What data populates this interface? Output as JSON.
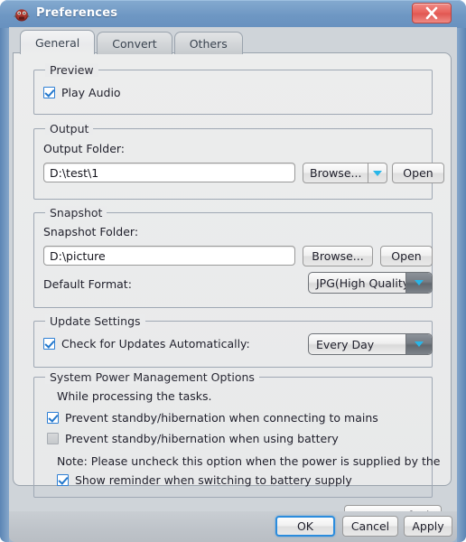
{
  "window": {
    "title": "Preferences",
    "icon": "app-icon",
    "close_label": "X",
    "frame_color": "#6e97c3",
    "close_color": "#e8625c"
  },
  "tabs": [
    {
      "label": "General",
      "active": true
    },
    {
      "label": "Convert",
      "active": false
    },
    {
      "label": "Others",
      "active": false
    }
  ],
  "groups": {
    "preview": {
      "legend": "Preview",
      "play_audio": {
        "label": "Play Audio",
        "checked": true
      }
    },
    "output": {
      "legend": "Output",
      "folder_label": "Output Folder:",
      "folder_value": "D:\\test\\1",
      "browse_label": "Browse...",
      "open_label": "Open"
    },
    "snapshot": {
      "legend": "Snapshot",
      "folder_label": "Snapshot Folder:",
      "folder_value": "D:\\picture",
      "browse_label": "Browse...",
      "open_label": "Open",
      "format_label": "Default Format:",
      "format_value": "JPG(High Quality)"
    },
    "update": {
      "legend": "Update Settings",
      "check_label": "Check for Updates Automatically:",
      "check_checked": true,
      "frequency_value": "Every Day"
    },
    "power": {
      "legend": "System Power Management Options",
      "intro": "While processing the tasks.",
      "mains": {
        "label": "Prevent standby/hibernation when connecting to mains",
        "checked": true
      },
      "battery": {
        "label": "Prevent standby/hibernation when using battery",
        "checked": false,
        "disabled": true
      },
      "note": "Note: Please uncheck this option when the power is supplied by the",
      "reminder": {
        "label": "Show reminder when switching to battery supply",
        "checked": true
      }
    }
  },
  "actions": {
    "restore_defaults": "Restore Defaults",
    "ok": "OK",
    "cancel": "Cancel",
    "apply": "Apply"
  },
  "colors": {
    "accent": "#2b8cdd",
    "arrow_cyan": "#29b6e8",
    "titlebar": "#6e97c3",
    "panel": "#eceded"
  }
}
